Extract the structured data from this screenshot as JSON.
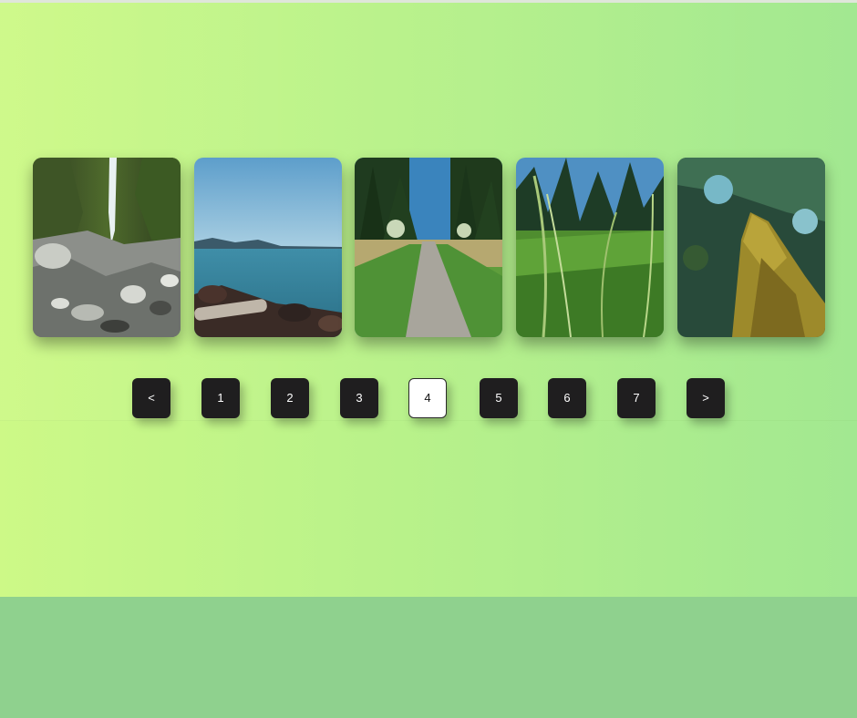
{
  "gallery": {
    "images": [
      {
        "name": "waterfall-rocks-photo",
        "alt": "waterfall"
      },
      {
        "name": "lake-rocky-shore-photo",
        "alt": "lake"
      },
      {
        "name": "forest-path-photo",
        "alt": "path"
      },
      {
        "name": "tall-grass-photo",
        "alt": "grass"
      },
      {
        "name": "mossy-tree-trunk-photo",
        "alt": "tree"
      }
    ]
  },
  "pagination": {
    "prev_label": "<",
    "next_label": ">",
    "pages": [
      "1",
      "2",
      "3",
      "4",
      "5",
      "6",
      "7"
    ],
    "current_page": "4"
  },
  "colors": {
    "gradient_start": "#cdf987",
    "gradient_end": "#a2e891",
    "bottom_band": "#8fd18e",
    "button_bg": "#1f1e1f",
    "button_active_bg": "#ffffff"
  }
}
